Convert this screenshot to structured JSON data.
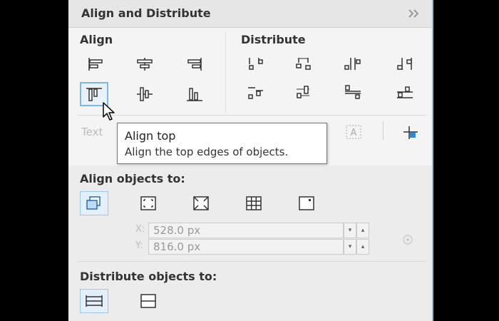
{
  "panel": {
    "title": "Align and Distribute",
    "collapse_icon": "double-chevron-right-icon"
  },
  "align": {
    "label": "Align",
    "buttons": [
      {
        "name": "align-left",
        "icon": "align-left-icon"
      },
      {
        "name": "align-center-horizontal",
        "icon": "align-center-horizontal-icon"
      },
      {
        "name": "align-right",
        "icon": "align-right-icon"
      },
      {
        "name": "align-top",
        "icon": "align-top-icon",
        "selected": true
      },
      {
        "name": "align-center-vertical",
        "icon": "align-center-vertical-icon"
      },
      {
        "name": "align-bottom",
        "icon": "align-bottom-icon"
      }
    ]
  },
  "distribute": {
    "label": "Distribute",
    "buttons": [
      {
        "name": "distribute-left",
        "icon": "distribute-left-icon"
      },
      {
        "name": "distribute-center-horizontal",
        "icon": "distribute-center-horizontal-icon"
      },
      {
        "name": "distribute-spacing-horizontal",
        "icon": "distribute-spacing-horizontal-icon"
      },
      {
        "name": "distribute-right",
        "icon": "distribute-right-icon"
      },
      {
        "name": "distribute-top",
        "icon": "distribute-top-icon"
      },
      {
        "name": "distribute-center-vertical",
        "icon": "distribute-center-vertical-icon"
      },
      {
        "name": "distribute-spacing-vertical",
        "icon": "distribute-spacing-vertical-icon"
      },
      {
        "name": "distribute-bottom",
        "icon": "distribute-bottom-icon"
      }
    ]
  },
  "text_row": {
    "label": "Text",
    "icons": [
      "text-align-icon",
      "outline-icon"
    ]
  },
  "tooltip": {
    "title": "Align top",
    "description": "Align the top edges of objects."
  },
  "align_objects_to": {
    "label": "Align objects to:",
    "buttons": [
      {
        "name": "active-objects",
        "icon": "active-objects-icon",
        "selected": true
      },
      {
        "name": "page-edge",
        "icon": "page-edge-icon"
      },
      {
        "name": "page-center",
        "icon": "page-center-icon"
      },
      {
        "name": "grid",
        "icon": "grid-icon"
      },
      {
        "name": "specified-point",
        "icon": "specified-point-icon"
      }
    ],
    "x_label": "X:",
    "x_value": "528.0 px",
    "y_label": "Y:",
    "y_value": "816.0 px",
    "lock_icon": "pick-point-icon"
  },
  "distribute_objects_to": {
    "label": "Distribute objects to:",
    "buttons": [
      {
        "name": "selection-extent",
        "icon": "selection-extent-icon",
        "selected": true
      },
      {
        "name": "page-extent",
        "icon": "page-extent-icon"
      }
    ]
  },
  "colors": {
    "accent": "#7fb8e8",
    "panel_bg": "#f4f4f4",
    "header_bg": "#e6e6e6"
  }
}
